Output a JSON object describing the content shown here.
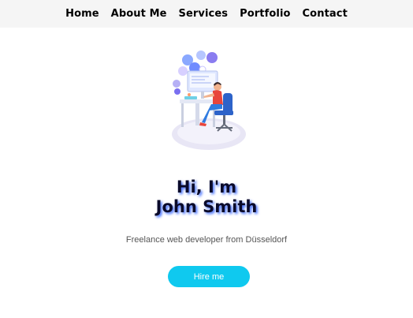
{
  "nav": {
    "items": [
      {
        "label": "Home"
      },
      {
        "label": "About Me"
      },
      {
        "label": "Services"
      },
      {
        "label": "Portfolio"
      },
      {
        "label": "Contact"
      }
    ]
  },
  "hero": {
    "illustration": "developer-at-desk-illustration",
    "title_line1": "Hi, I'm",
    "title_line2": "John Smith",
    "subtitle": "Freelance web developer from Düsseldorf",
    "button_label": "Hire me"
  },
  "colors": {
    "nav_background": "#f5f5f5",
    "button_background": "#0fc9ef",
    "title_shadow": "#003cff"
  }
}
